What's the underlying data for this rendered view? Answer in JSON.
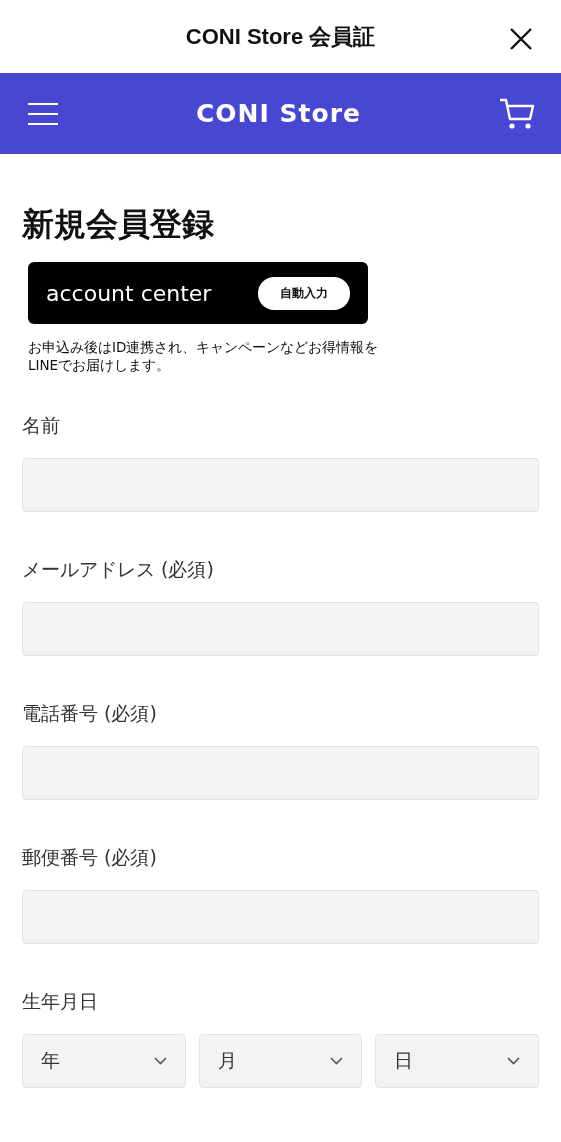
{
  "header": {
    "title": "CONI Store 会員証"
  },
  "navbar": {
    "logo": "CONI Store"
  },
  "heading": "新規会員登録",
  "account_center": {
    "label": "account center",
    "button": "自動入力",
    "note": "お申込み後はID連携され、キャンペーンなどお得情報を\nLINEでお届けします。"
  },
  "fields": [
    {
      "kind": "text",
      "label": "名前"
    },
    {
      "kind": "text",
      "label": "メールアドレス (必須)"
    },
    {
      "kind": "text",
      "label": "電話番号 (必須)"
    },
    {
      "kind": "text",
      "label": "郵便番号 (必須)"
    },
    {
      "kind": "date",
      "label": "生年月日",
      "selects": [
        {
          "value": "年"
        },
        {
          "value": "月"
        },
        {
          "value": "日"
        }
      ]
    }
  ]
}
